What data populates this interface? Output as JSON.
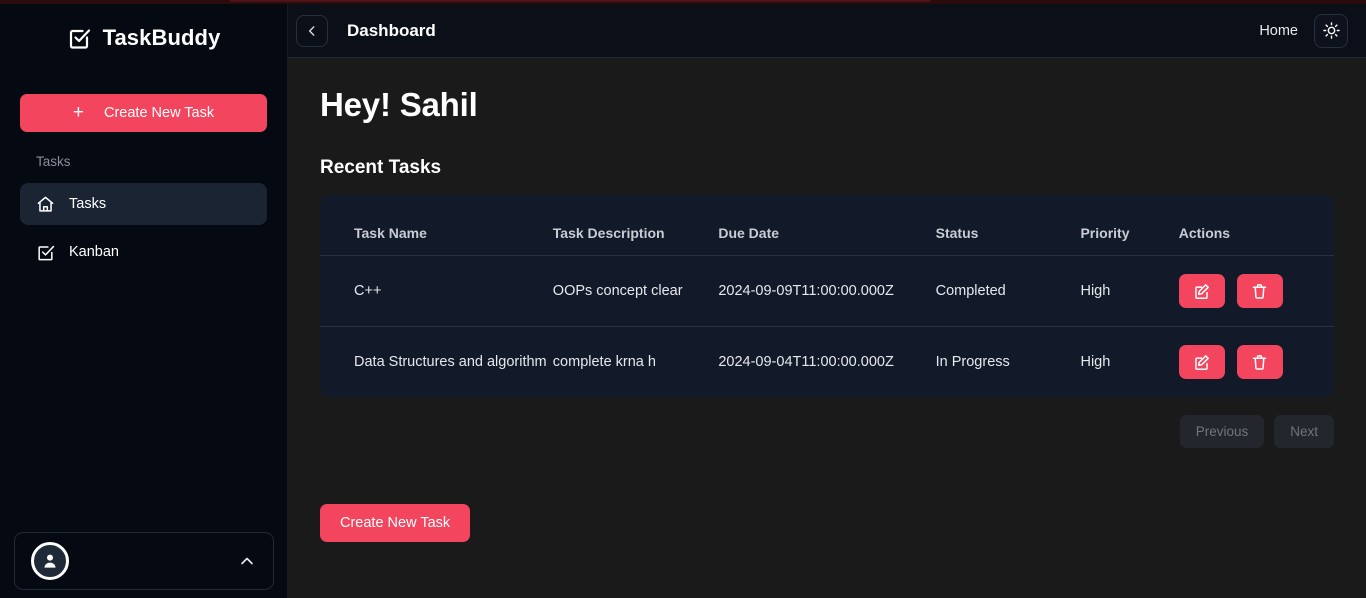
{
  "brand": {
    "name": "TaskBuddy",
    "logo_icon": "checkbox-check-icon"
  },
  "sidebar": {
    "create_task_label": "Create New Task",
    "create_task_icon": "plus-icon",
    "section_label": "Tasks",
    "items": [
      {
        "label": "Tasks",
        "icon": "home-icon",
        "active": true
      },
      {
        "label": "Kanban",
        "icon": "checkbox-check-icon",
        "active": false
      }
    ],
    "profile": {
      "avatar_icon": "user-icon",
      "chevron_icon": "chevron-up-icon"
    }
  },
  "topbar": {
    "collapse_icon": "chevron-left-icon",
    "title": "Dashboard",
    "home_label": "Home",
    "theme_icon": "sun-icon"
  },
  "main": {
    "greeting": "Hey! Sahil",
    "section_title": "Recent Tasks",
    "table": {
      "columns": [
        "Task Name",
        "Task Description",
        "Due Date",
        "Status",
        "Priority",
        "Actions"
      ],
      "rows": [
        {
          "task_name": "C++",
          "task_description": "OOPs concept clear",
          "due_date": "2024-09-09T11:00:00.000Z",
          "status": "Completed",
          "priority": "High",
          "edit_icon": "edit-pencil-icon",
          "delete_icon": "trash-icon"
        },
        {
          "task_name": "Data Structures and algorithm",
          "task_description": "complete krna h",
          "due_date": "2024-09-04T11:00:00.000Z",
          "status": "In Progress",
          "priority": "High",
          "edit_icon": "edit-pencil-icon",
          "delete_icon": "trash-icon"
        }
      ]
    },
    "pagination": {
      "previous_label": "Previous",
      "next_label": "Next"
    },
    "create_task_label": "Create New Task"
  },
  "colors": {
    "accent": "#f4455e",
    "sidebar_bg": "#050912",
    "content_bg": "#1a1a1a",
    "card_bg": "#121a29",
    "topbar_bg": "#0b0f18"
  }
}
